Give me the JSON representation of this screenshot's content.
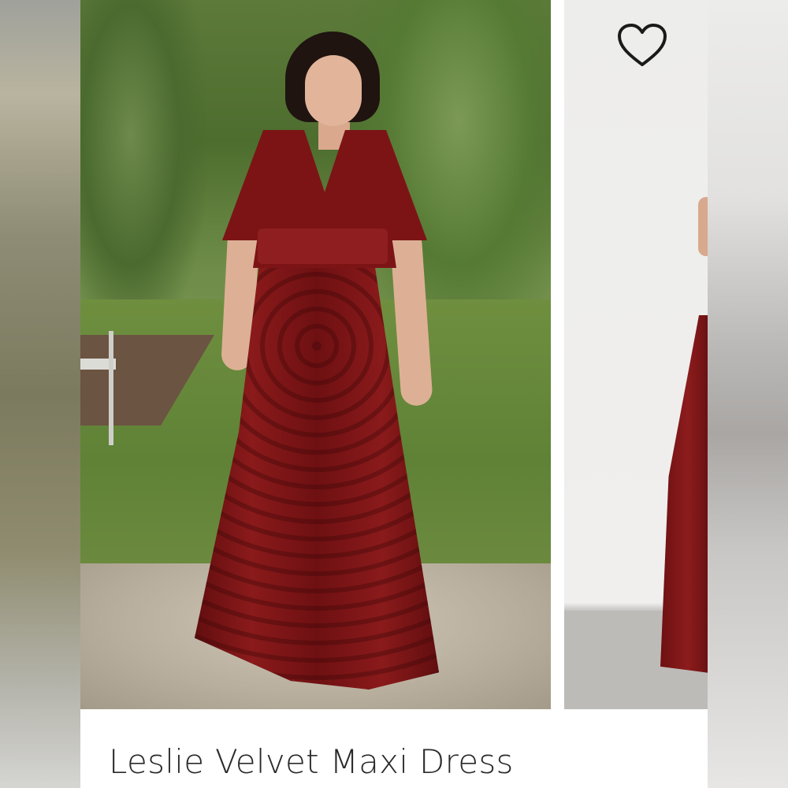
{
  "product": {
    "title": "Leslie Velvet Maxi Dress",
    "favorite_icon": "heart-outline-icon"
  },
  "colors": {
    "dress": "#7c1416",
    "background": "#ffffff",
    "title_text": "#2a2a2a"
  }
}
